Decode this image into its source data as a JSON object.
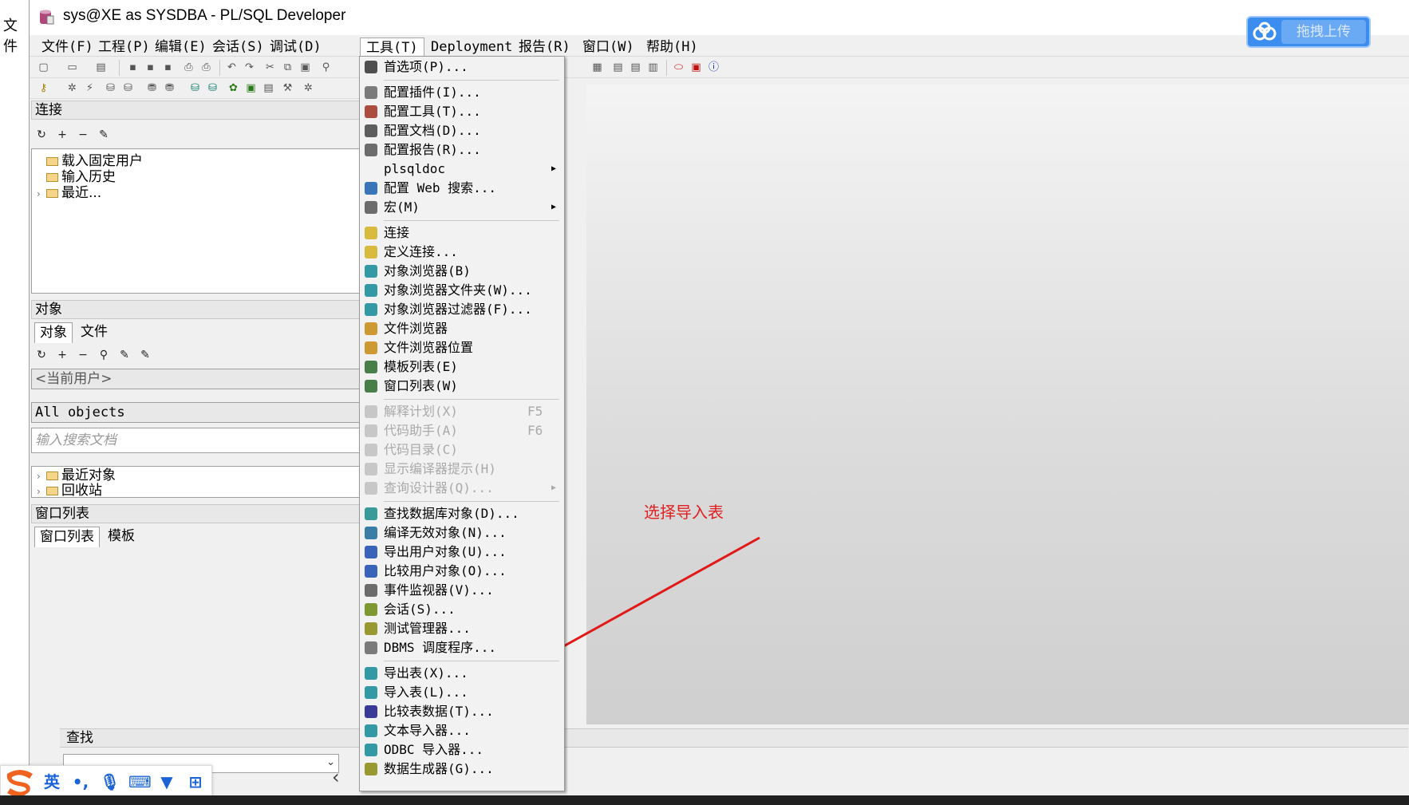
{
  "desktop": {
    "left_label": "文件"
  },
  "window": {
    "title": "sys@XE as SYSDBA - PL/SQL Developer"
  },
  "upload_widget": {
    "label": "拖拽上传"
  },
  "menubar": [
    "文件(F)",
    "工程(P)",
    "编辑(E)",
    "会话(S)",
    "调试(D)",
    "工具(T)",
    "Deployment",
    "报告(R)",
    "窗口(W)",
    "帮助(H)"
  ],
  "connection_pane": {
    "header": "连接",
    "tree": [
      "载入固定用户",
      "输入历史",
      "最近..."
    ]
  },
  "objects_pane": {
    "header": "对象",
    "tabs": [
      "对象",
      "文件"
    ],
    "user_select": "<当前用户>",
    "filter_select": "All objects",
    "search_placeholder": "输入搜索文档",
    "tree": [
      "最近对象",
      "回收站"
    ]
  },
  "window_list_pane": {
    "header": "窗口列表",
    "tabs": [
      "窗口列表",
      "模板"
    ]
  },
  "find_pane": {
    "header": "查找"
  },
  "annotation": {
    "text": "选择导入表",
    "color": "#e02020"
  },
  "ime": {
    "lang_label": "英"
  },
  "tools_menu": {
    "groups": [
      [
        {
          "label": "首选项(P)...",
          "icon": "wrench-icon",
          "enabled": true
        }
      ],
      [
        {
          "label": "配置插件(I)...",
          "icon": "plugin-icon",
          "enabled": true
        },
        {
          "label": "配置工具(T)...",
          "icon": "tools-icon",
          "enabled": true
        },
        {
          "label": "配置文档(D)...",
          "icon": "document-icon",
          "enabled": true
        },
        {
          "label": "配置报告(R)...",
          "icon": "report-icon",
          "enabled": true
        },
        {
          "label": "plsqldoc",
          "icon": "",
          "enabled": true,
          "submenu": true
        },
        {
          "label": "配置 Web 搜索...",
          "icon": "web-search-icon",
          "enabled": true
        },
        {
          "label": "宏(M)",
          "icon": "macro-icon",
          "enabled": true,
          "submenu": true
        }
      ],
      [
        {
          "label": "连接",
          "icon": "database-icon",
          "enabled": true
        },
        {
          "label": "定义连接...",
          "icon": "database-icon",
          "enabled": true
        },
        {
          "label": "对象浏览器(B)",
          "icon": "object-browser-icon",
          "enabled": true
        },
        {
          "label": "对象浏览器文件夹(W)...",
          "icon": "object-browser-icon",
          "enabled": true
        },
        {
          "label": "对象浏览器过滤器(F)...",
          "icon": "object-browser-icon",
          "enabled": true
        },
        {
          "label": "文件浏览器",
          "icon": "file-browser-icon",
          "enabled": true
        },
        {
          "label": "文件浏览器位置",
          "icon": "file-browser-icon",
          "enabled": true
        },
        {
          "label": "模板列表(E)",
          "icon": "template-icon",
          "enabled": true
        },
        {
          "label": "窗口列表(W)",
          "icon": "window-list-icon",
          "enabled": true
        }
      ],
      [
        {
          "label": "解释计划(X)",
          "icon": "explain-icon",
          "enabled": false,
          "shortcut": "F5"
        },
        {
          "label": "代码助手(A)",
          "icon": "code-assist-icon",
          "enabled": false,
          "shortcut": "F6"
        },
        {
          "label": "代码目录(C)",
          "icon": "code-contents-icon",
          "enabled": false
        },
        {
          "label": "显示编译器提示(H)",
          "icon": "hint-icon",
          "enabled": false
        },
        {
          "label": "查询设计器(Q)...",
          "icon": "query-designer-icon",
          "enabled": false,
          "submenu": true
        }
      ],
      [
        {
          "label": "查找数据库对象(D)...",
          "icon": "find-db-icon",
          "enabled": true
        },
        {
          "label": "编译无效对象(N)...",
          "icon": "compile-icon",
          "enabled": true
        },
        {
          "label": "导出用户对象(U)...",
          "icon": "export-user-icon",
          "enabled": true
        },
        {
          "label": "比较用户对象(O)...",
          "icon": "compare-user-icon",
          "enabled": true
        },
        {
          "label": "事件监视器(V)...",
          "icon": "event-monitor-icon",
          "enabled": true
        },
        {
          "label": "会话(S)...",
          "icon": "session-icon",
          "enabled": true
        },
        {
          "label": "测试管理器...",
          "icon": "test-manager-icon",
          "enabled": true
        },
        {
          "label": "DBMS 调度程序...",
          "icon": "scheduler-icon",
          "enabled": true
        }
      ],
      [
        {
          "label": "导出表(X)...",
          "icon": "export-table-icon",
          "enabled": true
        },
        {
          "label": "导入表(L)...",
          "icon": "import-table-icon",
          "enabled": true
        },
        {
          "label": "比较表数据(T)...",
          "icon": "compare-table-icon",
          "enabled": true
        },
        {
          "label": "文本导入器...",
          "icon": "text-import-icon",
          "enabled": true
        },
        {
          "label": "ODBC 导入器...",
          "icon": "odbc-import-icon",
          "enabled": true
        },
        {
          "label": "数据生成器(G)...",
          "icon": "data-generator-icon",
          "enabled": true
        }
      ]
    ]
  }
}
